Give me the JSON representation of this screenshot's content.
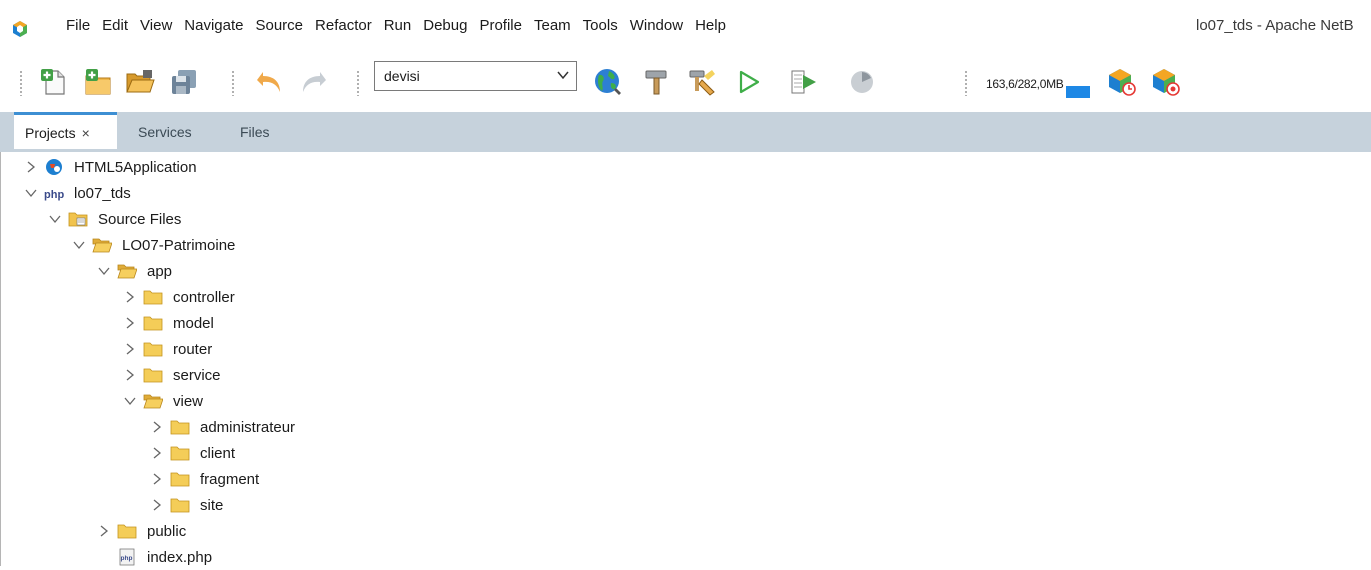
{
  "menu": [
    "File",
    "Edit",
    "View",
    "Navigate",
    "Source",
    "Refactor",
    "Run",
    "Debug",
    "Profile",
    "Team",
    "Tools",
    "Window",
    "Help"
  ],
  "window_title": "lo07_tds - Apache NetB",
  "toolbar": {
    "config_value": "devisi",
    "memory_text": "163,6/282,0MB"
  },
  "tabs": [
    {
      "label": "Projects",
      "close": "×"
    },
    {
      "label": "Services"
    },
    {
      "label": "Files"
    }
  ],
  "tree": [
    {
      "label": "HTML5Application",
      "icon": "html5-project-icon",
      "expanded": false
    },
    {
      "label": "lo07_tds",
      "icon": "php-project-icon",
      "expanded": true
    },
    {
      "label": "Source Files",
      "icon": "source-folder-icon",
      "expanded": true
    },
    {
      "label": "LO07-Patrimoine",
      "icon": "folder-open-icon",
      "expanded": true
    },
    {
      "label": "app",
      "icon": "folder-open-icon",
      "expanded": true
    },
    {
      "label": "controller",
      "icon": "folder-icon",
      "expanded": false
    },
    {
      "label": "model",
      "icon": "folder-icon",
      "expanded": false
    },
    {
      "label": "router",
      "icon": "folder-icon",
      "expanded": false
    },
    {
      "label": "service",
      "icon": "folder-icon",
      "expanded": false
    },
    {
      "label": "view",
      "icon": "folder-open-icon",
      "expanded": true
    },
    {
      "label": "administrateur",
      "icon": "folder-icon",
      "expanded": false
    },
    {
      "label": "client",
      "icon": "folder-icon",
      "expanded": false
    },
    {
      "label": "fragment",
      "icon": "folder-icon",
      "expanded": false
    },
    {
      "label": "site",
      "icon": "folder-icon",
      "expanded": false
    },
    {
      "label": "public",
      "icon": "folder-icon",
      "expanded": false
    },
    {
      "label": "index.php",
      "icon": "php-file-icon",
      "expanded": null
    }
  ]
}
